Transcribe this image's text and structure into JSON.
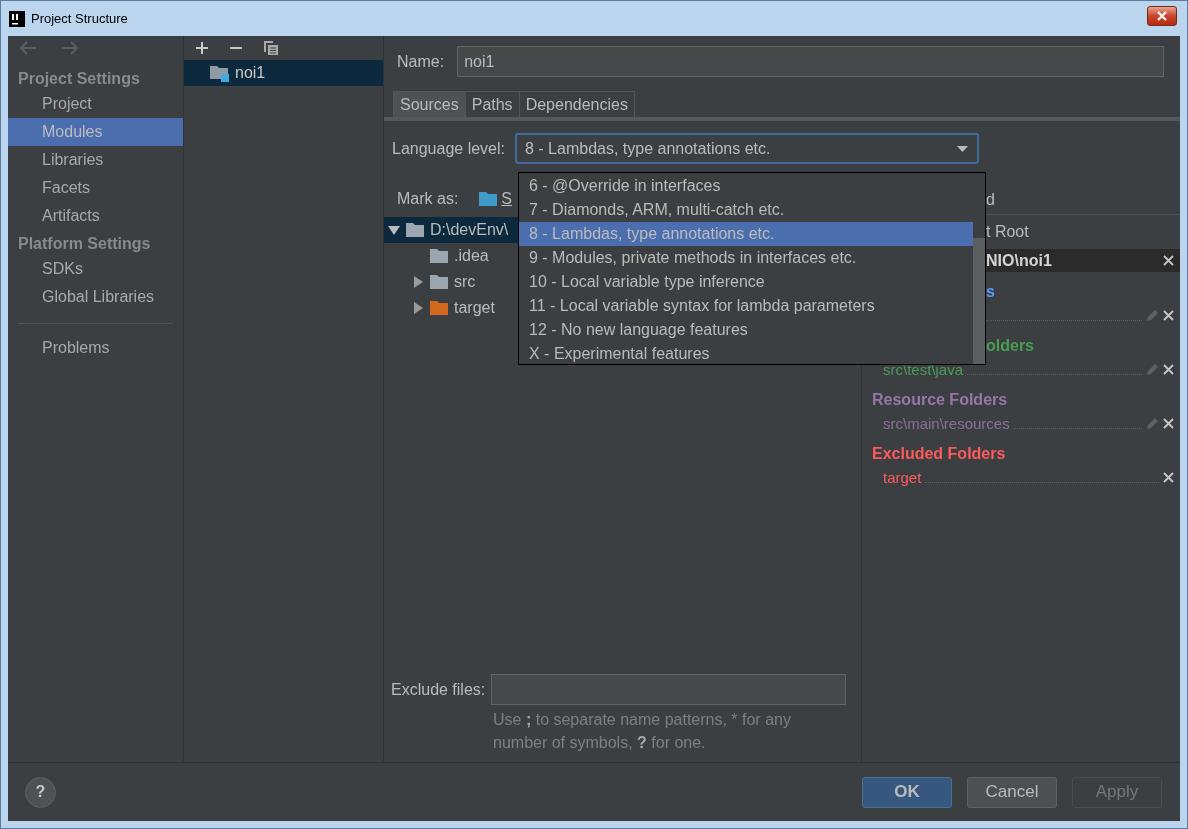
{
  "window": {
    "title": "Project Structure"
  },
  "sidebar": {
    "sections": [
      {
        "title": "Project Settings",
        "items": [
          {
            "label": "Project",
            "selected": false
          },
          {
            "label": "Modules",
            "selected": true
          },
          {
            "label": "Libraries",
            "selected": false
          },
          {
            "label": "Facets",
            "selected": false
          },
          {
            "label": "Artifacts",
            "selected": false
          }
        ]
      },
      {
        "title": "Platform Settings",
        "items": [
          {
            "label": "SDKs",
            "selected": false
          },
          {
            "label": "Global Libraries",
            "selected": false
          }
        ]
      }
    ],
    "bottom_items": [
      {
        "label": "Problems",
        "selected": false
      }
    ]
  },
  "modules": [
    {
      "name": "noi1",
      "selected": true
    }
  ],
  "name_field": {
    "label": "Name:",
    "value": "noi1"
  },
  "tabs": [
    {
      "label": "Sources",
      "selected": true
    },
    {
      "label": "Paths",
      "selected": false
    },
    {
      "label": "Dependencies",
      "selected": false
    }
  ],
  "language_level": {
    "label": "Language level:",
    "value": "8 - Lambdas, type annotations etc.",
    "options": [
      {
        "label": "6 - @Override in interfaces",
        "selected": false
      },
      {
        "label": "7 - Diamonds, ARM, multi-catch etc.",
        "selected": false
      },
      {
        "label": "8 - Lambdas, type annotations etc.",
        "selected": true
      },
      {
        "label": "9 - Modules, private methods in interfaces etc.",
        "selected": false
      },
      {
        "label": "10 - Local variable type inference",
        "selected": false
      },
      {
        "label": "11 - Local variable syntax for lambda parameters",
        "selected": false
      },
      {
        "label": "12 - No new language features",
        "selected": false
      },
      {
        "label": "X - Experimental features",
        "selected": false
      }
    ]
  },
  "mark_as": {
    "label": "Mark as:",
    "button": "S"
  },
  "tree": [
    {
      "label": "D:\\devEnv\\",
      "kind": "folder",
      "expanded": true,
      "selected": true,
      "children": [
        {
          "label": ".idea",
          "kind": "folder",
          "selected": false
        },
        {
          "label": "src",
          "kind": "folder",
          "expanded": false,
          "selected": false
        },
        {
          "label": "target",
          "kind": "excluded",
          "expanded": false,
          "selected": false
        }
      ]
    }
  ],
  "roots_panel": {
    "header": "d",
    "root_title": "t Root",
    "root_path": "NIO\\noi1",
    "groups": [
      {
        "kind": "source",
        "title": "s",
        "partly_hidden": true,
        "paths": [
          {
            "editable": true
          }
        ]
      },
      {
        "kind": "tests",
        "title": "olders",
        "partly_hidden": true,
        "paths": [
          {
            "label": "src\\test\\java",
            "editable": true
          }
        ]
      },
      {
        "kind": "resource",
        "title": "Resource Folders",
        "partly_hidden": false,
        "paths": [
          {
            "label": "src\\main\\resources",
            "editable": true
          }
        ]
      },
      {
        "kind": "excluded",
        "title": "Excluded Folders",
        "partly_hidden": false,
        "paths": [
          {
            "label": "target",
            "editable": false
          }
        ]
      }
    ]
  },
  "exclude_files": {
    "label": "Exclude files:",
    "hint": "Use **;** to separate name patterns, * for any number of symbols, **?** for one."
  },
  "footer": {
    "help": "?",
    "buttons": [
      {
        "label": "OK",
        "kind": "default"
      },
      {
        "label": "Cancel",
        "kind": "normal"
      },
      {
        "label": "Apply",
        "kind": "disabled"
      }
    ]
  }
}
